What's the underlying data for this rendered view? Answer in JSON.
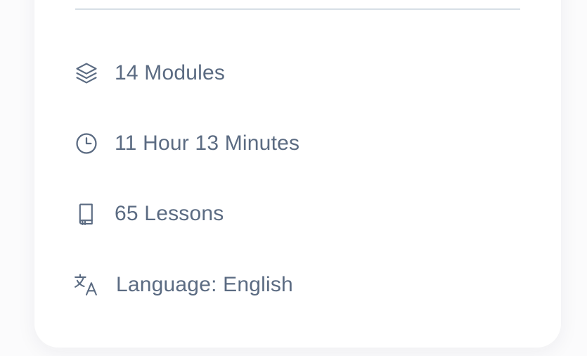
{
  "course_info": {
    "items": [
      {
        "icon": "layers-icon",
        "label": "14 Modules"
      },
      {
        "icon": "clock-icon",
        "label": "11 Hour 13 Minutes"
      },
      {
        "icon": "book-icon",
        "label": "65 Lessons"
      },
      {
        "icon": "translate-icon",
        "label": "Language: English"
      }
    ]
  },
  "colors": {
    "text": "#5b6b82",
    "divider": "#d7dfe6",
    "card": "#ffffff",
    "background": "#fbfbfc"
  }
}
